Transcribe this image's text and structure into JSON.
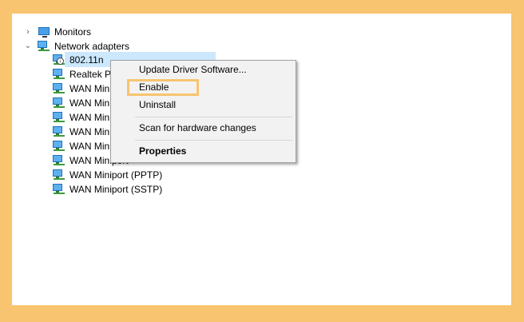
{
  "tree": {
    "monitors": {
      "label": "Monitors",
      "expanded": false
    },
    "network_adapters": {
      "label": "Network adapters",
      "expanded": true,
      "items": [
        {
          "label": "802.11n",
          "selected": true,
          "icon": "network-adapter-disabled-icon"
        },
        {
          "label": "Realtek PC",
          "icon": "network-adapter-icon"
        },
        {
          "label": "WAN Min",
          "icon": "network-adapter-icon"
        },
        {
          "label": "WAN Min",
          "icon": "network-adapter-icon"
        },
        {
          "label": "WAN Min",
          "icon": "network-adapter-icon"
        },
        {
          "label": "WAN Min",
          "icon": "network-adapter-icon"
        },
        {
          "label": "WAN Min",
          "icon": "network-adapter-icon"
        },
        {
          "label": "WAN Miniport",
          "icon": "network-adapter-icon"
        },
        {
          "label": "WAN Miniport (PPTP)",
          "icon": "network-adapter-icon"
        },
        {
          "label": "WAN Miniport (SSTP)",
          "icon": "network-adapter-icon"
        }
      ]
    }
  },
  "context_menu": {
    "update_driver": "Update Driver Software...",
    "enable": "Enable",
    "uninstall": "Uninstall",
    "scan": "Scan for hardware changes",
    "properties": "Properties"
  },
  "colors": {
    "frame": "#F8C46F",
    "selection": "#cce8ff",
    "menu_bg": "#f2f2f2",
    "highlight_box": "#F8C46F"
  },
  "icons": {
    "collapsed": "chevron-right-icon",
    "expanded": "chevron-down-icon"
  }
}
